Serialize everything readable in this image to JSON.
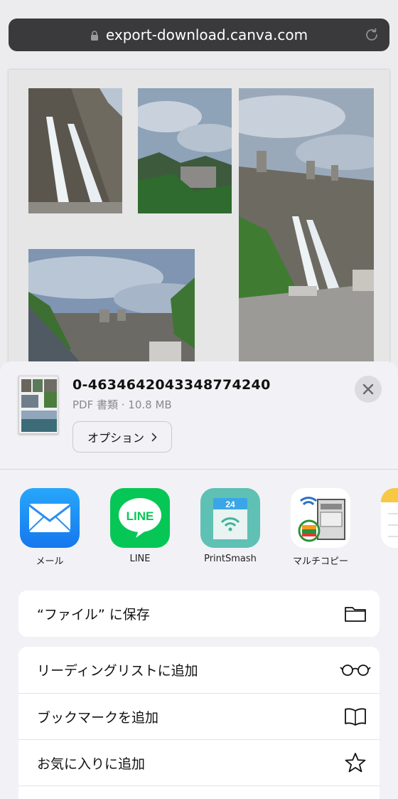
{
  "browser": {
    "url": "export-download.canva.com"
  },
  "file": {
    "name": "0-4634642043348774240",
    "meta": "PDF 書類 · 10.8 MB",
    "options_label": "オプション"
  },
  "apps": [
    {
      "label": "メール",
      "icon": "mail-icon"
    },
    {
      "label": "LINE",
      "icon": "line-icon",
      "icon_text": "LINE"
    },
    {
      "label": "PrintSmash",
      "icon": "printsmash-icon",
      "icon_text": "24"
    },
    {
      "label": "マルチコピー",
      "icon": "multicopy-icon"
    }
  ],
  "actions_group1": [
    {
      "label": "“ファイル” に保存",
      "icon": "folder-icon"
    }
  ],
  "actions_group2": [
    {
      "label": "リーディングリストに追加",
      "icon": "glasses-icon"
    },
    {
      "label": "ブックマークを追加",
      "icon": "book-icon"
    },
    {
      "label": "お気に入りに追加",
      "icon": "star-icon"
    }
  ],
  "colors": {
    "url_bar": "#3a3a3c",
    "sheet_bg": "#f2f2f6",
    "mail_blue": "#1a8cf5",
    "line_green": "#06c755",
    "printsmash_teal": "#5fc0b4"
  }
}
